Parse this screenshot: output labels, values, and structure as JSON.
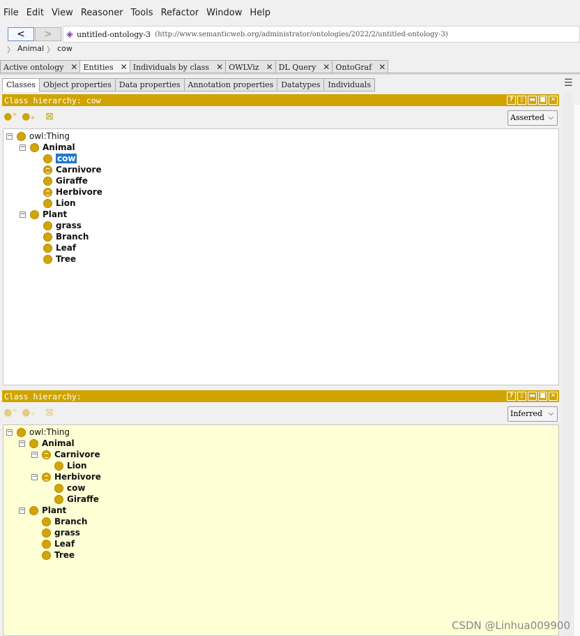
{
  "menu": [
    "File",
    "Edit",
    "View",
    "Reasoner",
    "Tools",
    "Refactor",
    "Window",
    "Help"
  ],
  "nav": {
    "back": "<",
    "forward": ">",
    "ontology": "untitled-ontology-3",
    "iri": "(http://www.semanticweb.org/administrator/ontologies/2022/2/untitled-ontology-3)"
  },
  "breadcrumb": [
    "Animal",
    "cow"
  ],
  "main_tabs": [
    "Active ontology",
    "Entities",
    "Individuals by class",
    "OWLViz",
    "DL Query",
    "OntoGraf"
  ],
  "sub_tabs": [
    "Classes",
    "Object properties",
    "Data properties",
    "Annotation properties",
    "Datatypes",
    "Individuals"
  ],
  "panel1": {
    "title": "Class hierarchy: cow",
    "mode": "Asserted"
  },
  "panel2": {
    "title": "Class hierarchy:",
    "mode": "Inferred"
  },
  "tree1": [
    "owl:Thing",
    "Animal",
    "cow",
    "Carnivore",
    "Giraffe",
    "Herbivore",
    "Lion",
    "Plant",
    "grass",
    "Branch",
    "Leaf",
    "Tree"
  ],
  "tree2": [
    "owl:Thing",
    "Animal",
    "Carnivore",
    "Lion",
    "Herbivore",
    "cow",
    "Giraffe",
    "Plant",
    "Branch",
    "grass",
    "Leaf",
    "Tree"
  ],
  "header_buttons": [
    "?",
    "▯",
    "▬",
    "■",
    "✕"
  ],
  "watermark": "CSDN @Linhua009900",
  "colors": {
    "accent": "#cfa400",
    "selection": "#1f78d0",
    "inferred_bg": "#ffffd6"
  }
}
